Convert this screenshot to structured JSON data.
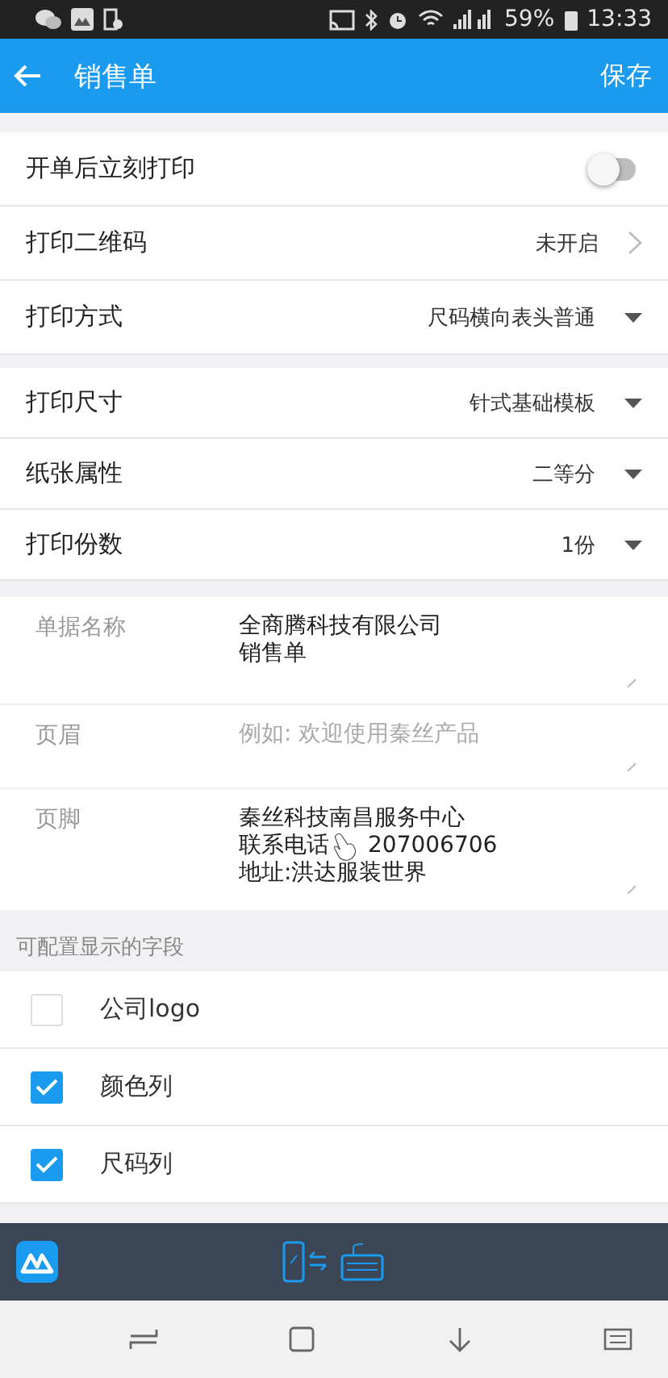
{
  "status_bar": {
    "battery": "59%",
    "time": "13:33"
  },
  "app_bar": {
    "title": "销售单",
    "action": "保存"
  },
  "print_on_open": {
    "label": "开单后立刻打印",
    "on": false
  },
  "settings_groups": [
    [
      {
        "label": "打印二维码",
        "value": "未开启",
        "kind": "link"
      },
      {
        "label": "打印方式",
        "value": "尺码横向表头普通",
        "kind": "dropdown"
      }
    ],
    [
      {
        "label": "打印尺寸",
        "value": "针式基础模板",
        "kind": "dropdown"
      },
      {
        "label": "纸张属性",
        "value": "二等分",
        "kind": "dropdown"
      },
      {
        "label": "打印份数",
        "value": "1份",
        "kind": "dropdown"
      }
    ]
  ],
  "text_fields": [
    {
      "label": "单据名称",
      "lines": [
        "全商腾科技有限公司",
        "销售单"
      ]
    },
    {
      "label": "页眉",
      "placeholder": "例如: 欢迎使用秦丝产品"
    },
    {
      "label": "页脚",
      "lines": [
        "秦丝科技南昌服务中心",
        "联系电话 207006706",
        "地址:洪达服装世界"
      ]
    }
  ],
  "fields_section": {
    "title": "可配置显示的字段",
    "items": [
      {
        "label": "公司logo",
        "checked": false
      },
      {
        "label": "颜色列",
        "checked": true
      },
      {
        "label": "尺码列",
        "checked": true
      }
    ]
  }
}
